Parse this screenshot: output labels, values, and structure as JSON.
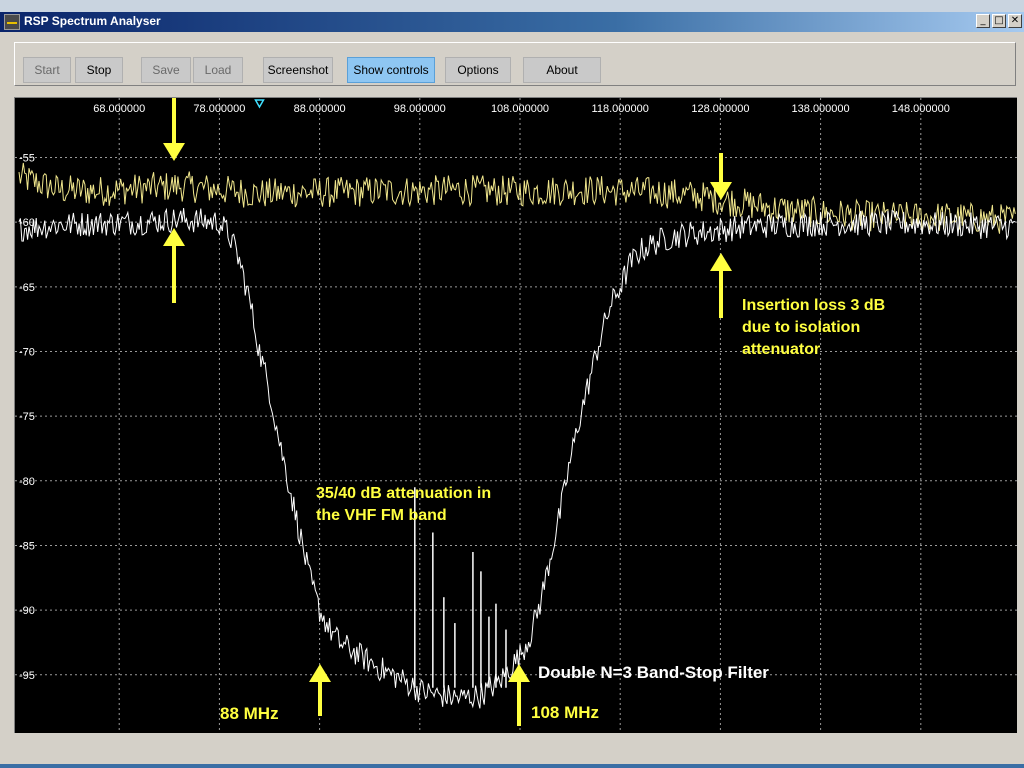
{
  "window": {
    "title": "RSP Spectrum Analyser"
  },
  "window_buttons": {
    "minimize": "_",
    "maximize": "□",
    "close": "✕"
  },
  "toolbar": [
    {
      "key": "start",
      "label": "Start",
      "enabled": false
    },
    {
      "key": "stop",
      "label": "Stop",
      "enabled": true
    },
    {
      "key": "save",
      "label": "Save",
      "enabled": false
    },
    {
      "key": "load",
      "label": "Load",
      "enabled": false
    },
    {
      "key": "screenshot",
      "label": "Screenshot",
      "enabled": true
    },
    {
      "key": "show-controls",
      "label": "Show controls",
      "enabled": true,
      "active": true
    },
    {
      "key": "options",
      "label": "Options",
      "enabled": true
    },
    {
      "key": "about",
      "label": "About",
      "enabled": true
    }
  ],
  "chart_data": {
    "type": "line",
    "x_tick_labels": [
      "68.000000",
      "78.000000",
      "88.000000",
      "98.000000",
      "108.000000",
      "118.000000",
      "128.000000",
      "138.000000",
      "148.000000"
    ],
    "x_ticks": [
      68,
      78,
      88,
      98,
      108,
      118,
      128,
      138,
      148
    ],
    "xlim": [
      57.6,
      157.6
    ],
    "y_tick_labels": [
      "-55",
      "-60",
      "-65",
      "-70",
      "-75",
      "-80",
      "-85",
      "-90",
      "-95"
    ],
    "y_ticks": [
      -55,
      -60,
      -65,
      -70,
      -75,
      -80,
      -85,
      -90,
      -95
    ],
    "ylim": [
      -99.5,
      -50.4
    ],
    "grid": true,
    "series": [
      {
        "color": "#f0e68c",
        "x": [
          58,
          62,
          66,
          70,
          74,
          78,
          82,
          86,
          90,
          94,
          98,
          102,
          106,
          110,
          114,
          118,
          122,
          126,
          130,
          134,
          138,
          142,
          146,
          150,
          154,
          157.5
        ],
        "y": [
          -56.5,
          -57.5,
          -57.6,
          -57.4,
          -57.2,
          -57.5,
          -57.8,
          -57.7,
          -57.7,
          -57.6,
          -57.6,
          -57.5,
          -57.6,
          -57.6,
          -57.5,
          -57.6,
          -57.7,
          -58,
          -58.5,
          -59,
          -59.3,
          -59.5,
          -59.6,
          -59.6,
          -59.7,
          -59.8
        ]
      },
      {
        "color": "#ffffff",
        "x": [
          58,
          62,
          66,
          70,
          74,
          78,
          79,
          80,
          81,
          82,
          83,
          84,
          85,
          86,
          87,
          88,
          89,
          90,
          92,
          94,
          96,
          98,
          100,
          102,
          104,
          106,
          108,
          109,
          110,
          111,
          112,
          113,
          114,
          115,
          116,
          117,
          118,
          119,
          120,
          122,
          124,
          126,
          128,
          130,
          132,
          134,
          136,
          138,
          140,
          142,
          144,
          146,
          148,
          150,
          152,
          154,
          157.5
        ],
        "y": [
          -60.5,
          -60.2,
          -60.1,
          -60,
          -59.8,
          -60,
          -61,
          -63,
          -66,
          -70,
          -73,
          -77,
          -80.5,
          -84,
          -87.5,
          -90,
          -91.5,
          -92.5,
          -93.5,
          -94.5,
          -95.3,
          -96.2,
          -96.6,
          -96.8,
          -96.6,
          -95.5,
          -93.5,
          -92,
          -89.5,
          -86,
          -82.5,
          -78.5,
          -75,
          -72,
          -69,
          -66.5,
          -65,
          -63.2,
          -62.2,
          -61.4,
          -61,
          -60.8,
          -60.6,
          -60.4,
          -60.3,
          -60.2,
          -60.2,
          -60.1,
          -60.1,
          -60.1,
          -60.1,
          -60.1,
          -60.1,
          -60.2,
          -60.2,
          -60.3,
          -60.3
        ]
      }
    ],
    "spurs": [
      {
        "x": 97.5,
        "y": -80.5
      },
      {
        "x": 99.3,
        "y": -84.0
      },
      {
        "x": 100.4,
        "y": -89.0
      },
      {
        "x": 101.5,
        "y": -91.0
      },
      {
        "x": 103.3,
        "y": -85.5
      },
      {
        "x": 104.1,
        "y": -87.0
      },
      {
        "x": 104.9,
        "y": -90.5
      },
      {
        "x": 105.6,
        "y": -89.5
      },
      {
        "x": 106.6,
        "y": -91.5
      }
    ],
    "marker_x": 82,
    "annotations": [
      {
        "key": "atten",
        "lines": [
          "35/40 dB attenuation in",
          "the VHF FM band"
        ],
        "color": "#ffff40"
      },
      {
        "key": "insertion",
        "lines": [
          "Insertion loss 3 dB",
          "due to isolation",
          "attenuator"
        ],
        "color": "#ffff40"
      },
      {
        "key": "filter",
        "lines": [
          "Double N=3 Band-Stop Filter"
        ],
        "color": "#ffffff"
      },
      {
        "key": "88",
        "lines": [
          "88 MHz"
        ],
        "color": "#ffff40"
      },
      {
        "key": "108",
        "lines": [
          "108  MHz"
        ],
        "color": "#ffff40"
      }
    ],
    "colors": {
      "background": "#000000",
      "grid": "#9a9a9a",
      "axis_text": "#ffffff",
      "arrow": "#ffff40"
    }
  }
}
